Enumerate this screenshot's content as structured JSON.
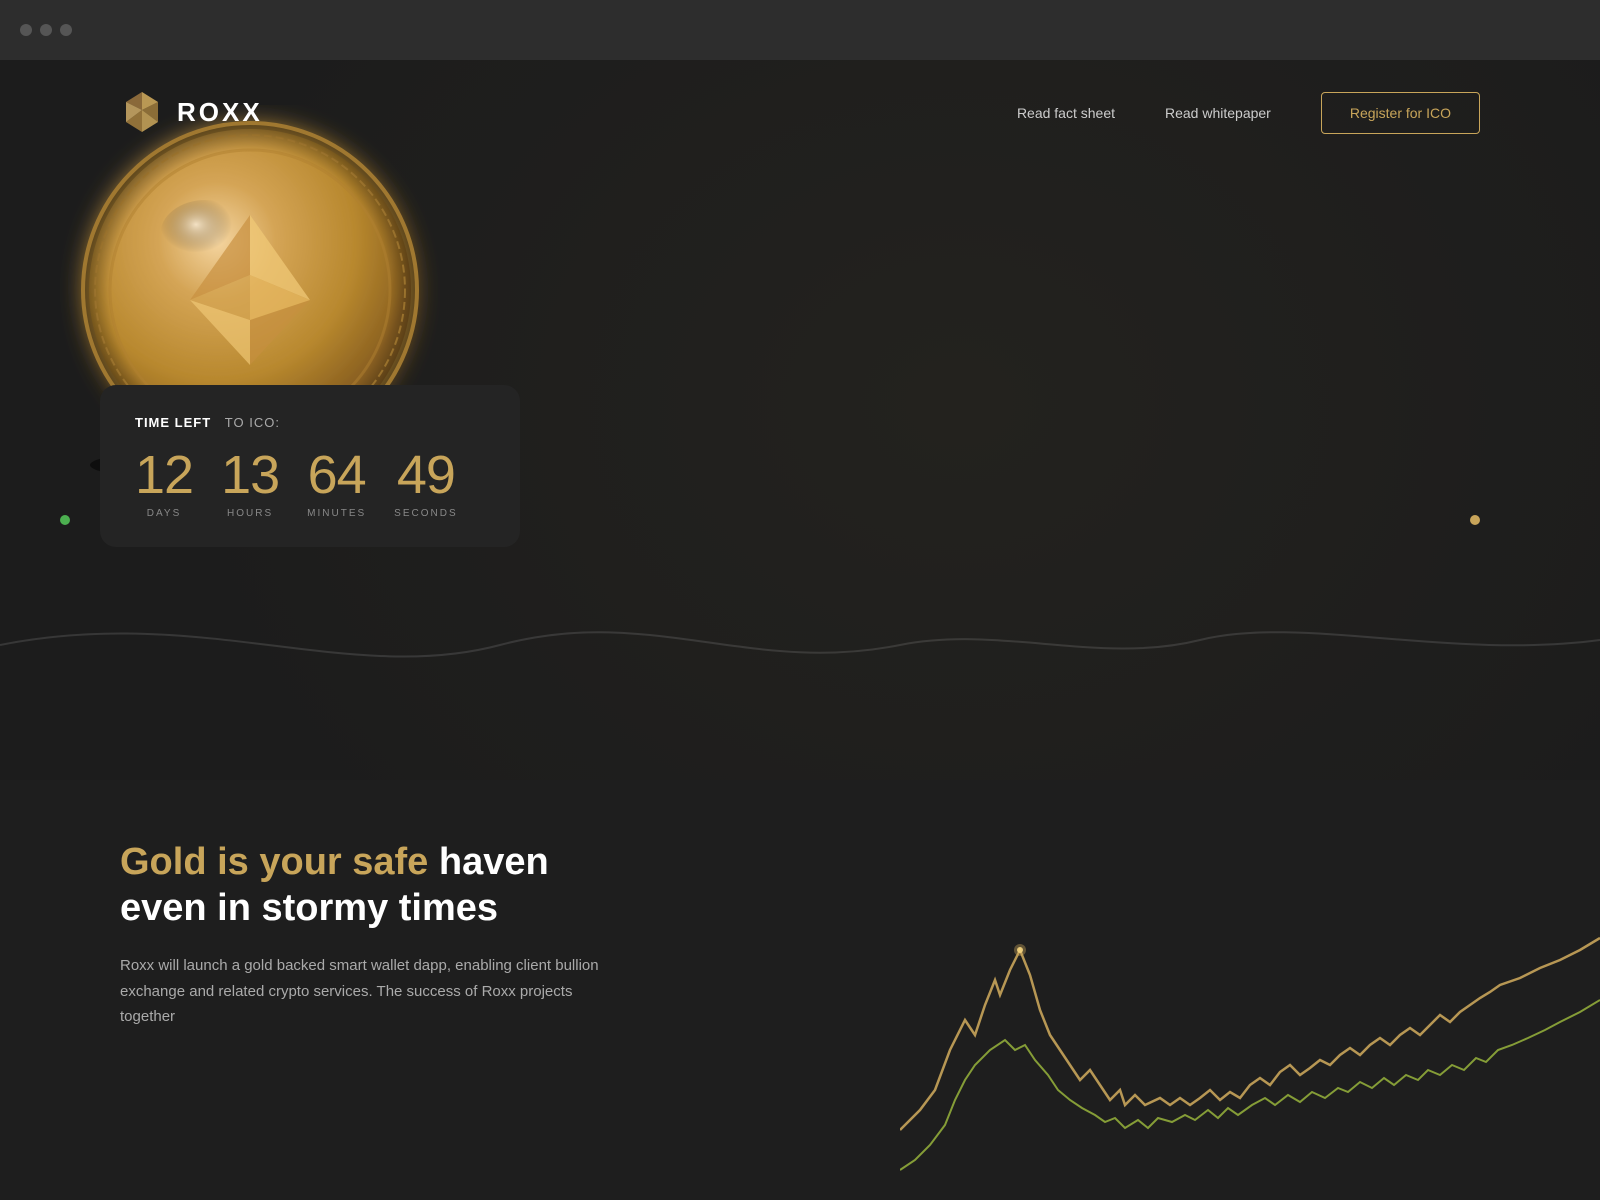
{
  "browser": {
    "dots": [
      "dot1",
      "dot2",
      "dot3"
    ]
  },
  "nav": {
    "logo_text": "ROXX",
    "links": [
      {
        "label": "Read fact sheet",
        "id": "read-fact-sheet"
      },
      {
        "label": "Read whitepaper",
        "id": "read-whitepaper"
      }
    ],
    "register_label": "Register for ICO"
  },
  "countdown": {
    "label_start": "TIME LEFT",
    "label_mid": "TO ICO:",
    "days_value": "12",
    "days_label": "DAYS",
    "hours_value": "13",
    "hours_label": "HOURS",
    "minutes_value": "64",
    "minutes_label": "MINUTES",
    "seconds_value": "49",
    "seconds_label": "SECONDS"
  },
  "hero_section": {
    "heading_highlight": "Gold is your safe",
    "heading_rest": " haven\neven in stormy times",
    "description": "Roxx will launch a gold backed smart wallet dapp, enabling client bullion exchange and related crypto services. The success of Roxx projects together"
  },
  "colors": {
    "gold": "#c8a55a",
    "green_dot": "#4caf50",
    "background": "#1c1c1c",
    "card_bg": "#242424",
    "text_primary": "#ffffff",
    "text_muted": "#aaaaaa"
  }
}
